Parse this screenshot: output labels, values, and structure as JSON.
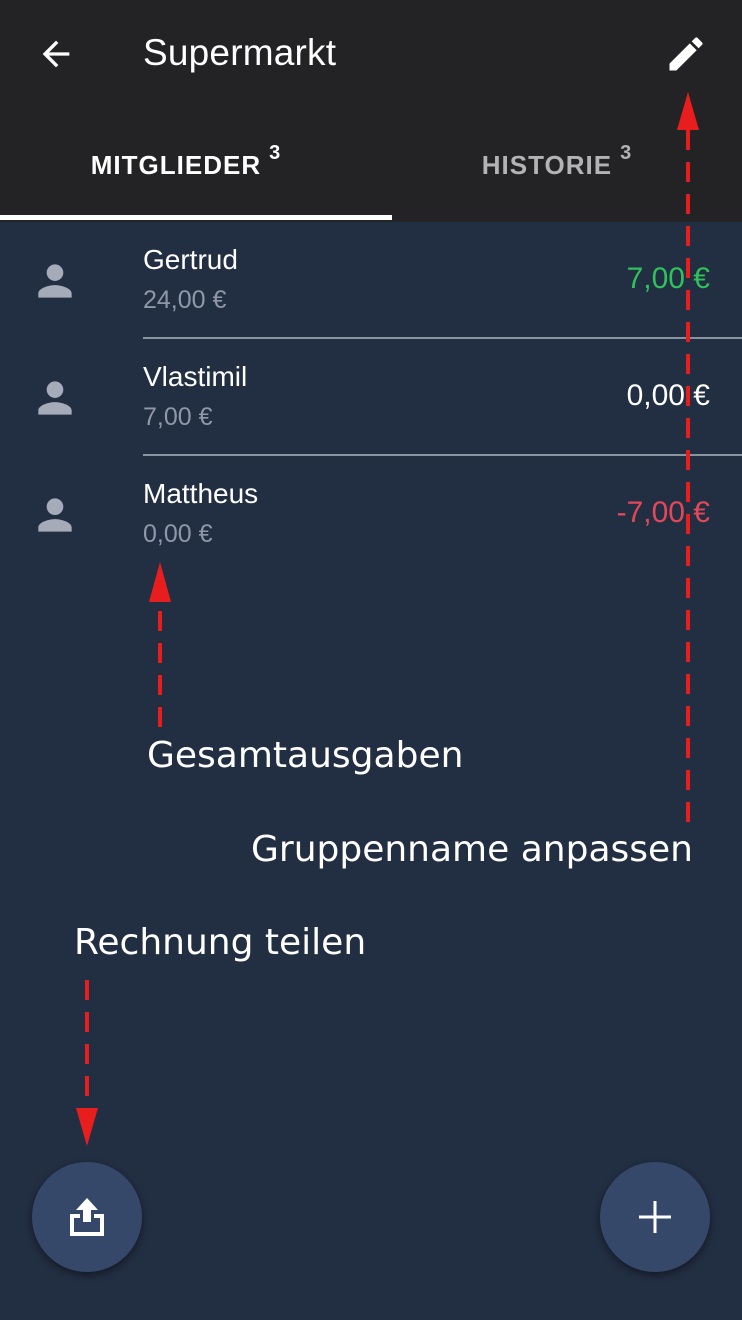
{
  "appbar": {
    "title": "Supermarkt",
    "back_icon": "arrow-back-icon",
    "edit_icon": "pencil-edit-icon"
  },
  "tabs": [
    {
      "label": "MITGLIEDER",
      "count": "3",
      "active": true
    },
    {
      "label": "HISTORIE",
      "count": "3",
      "active": false
    }
  ],
  "members": [
    {
      "name": "Gertrud",
      "total": "24,00 €",
      "balance": "7,00 €",
      "balance_state": "positive"
    },
    {
      "name": "Vlastimil",
      "total": "7,00 €",
      "balance": "0,00 €",
      "balance_state": "zero"
    },
    {
      "name": "Mattheus",
      "total": "0,00 €",
      "balance": "-7,00 €",
      "balance_state": "negative"
    }
  ],
  "annotations": {
    "total_expenses": "Gesamtausgaben",
    "rename_group": "Gruppenname anpassen",
    "share_bill": "Rechnung teilen"
  },
  "fabs": {
    "share_icon": "share-upload-icon",
    "add_icon": "plus-icon"
  },
  "colors": {
    "appbar": "#232325",
    "background": "#222e42",
    "positive": "#2fc25b",
    "negative": "#e3485a",
    "fab": "#36486a",
    "annotation_arrow": "#e81e1e"
  }
}
